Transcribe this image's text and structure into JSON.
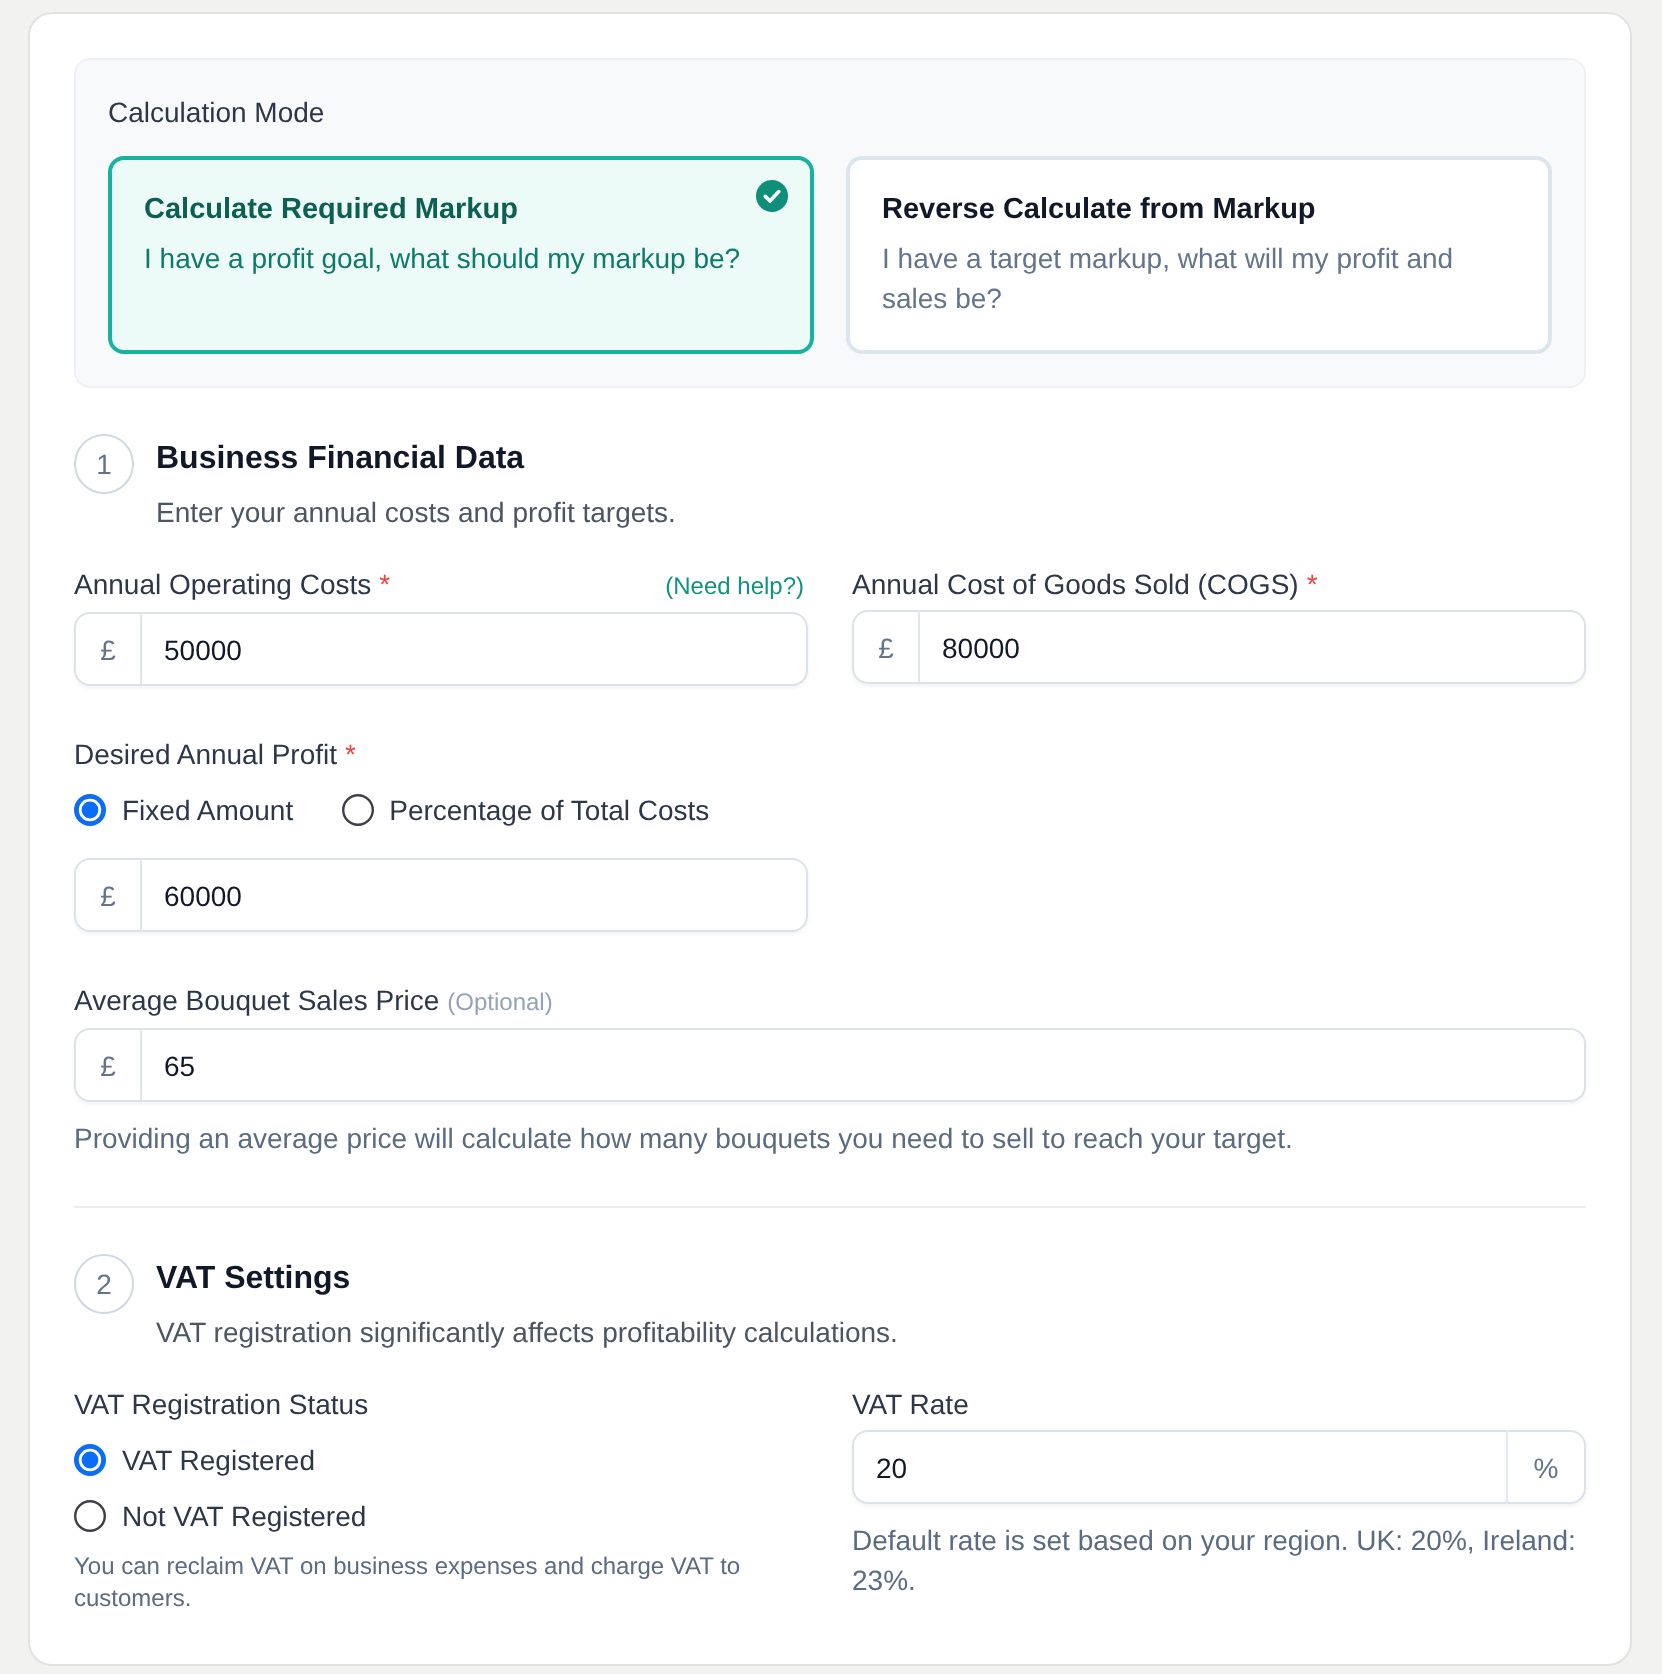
{
  "calculation_mode": {
    "label": "Calculation Mode",
    "options": [
      {
        "title": "Calculate Required Markup",
        "description": "I have a profit goal, what should my markup be?",
        "selected": true
      },
      {
        "title": "Reverse Calculate from Markup",
        "description": "I have a target markup, what will my profit and sales be?",
        "selected": false
      }
    ]
  },
  "business_financial_data": {
    "number": "1",
    "title": "Business Financial Data",
    "description": "Enter your annual costs and profit targets.",
    "annual_operating_costs": {
      "label": "Annual Operating Costs",
      "required_mark": "*",
      "help_link": "(Need help?)",
      "prefix": "£",
      "value": "50000"
    },
    "cost_of_goods_sold": {
      "label": "Annual Cost of Goods Sold (COGS)",
      "required_mark": "*",
      "prefix": "£",
      "value": "80000"
    },
    "desired_annual_profit": {
      "label": "Desired Annual Profit",
      "required_mark": "*",
      "options": [
        {
          "label": "Fixed Amount",
          "selected": true
        },
        {
          "label": "Percentage of Total Costs",
          "selected": false
        }
      ],
      "prefix": "£",
      "value": "60000"
    },
    "average_bouquet_sales_price": {
      "label": "Average Bouquet Sales Price",
      "optional_note": "(Optional)",
      "prefix": "£",
      "value": "65",
      "help": "Providing an average price will calculate how many bouquets you need to sell to reach your target."
    }
  },
  "vat_settings": {
    "number": "2",
    "title": "VAT Settings",
    "description": "VAT registration significantly affects profitability calculations.",
    "registration_status": {
      "label": "VAT Registration Status",
      "options": [
        {
          "label": "VAT Registered",
          "selected": true
        },
        {
          "label": "Not VAT Registered",
          "selected": false
        }
      ],
      "help": "You can reclaim VAT on business expenses and charge VAT to customers."
    },
    "vat_rate": {
      "label": "VAT Rate",
      "value": "20",
      "suffix": "%",
      "help": "Default rate is set based on your region. UK: 20%, Ireland: 23%."
    }
  }
}
